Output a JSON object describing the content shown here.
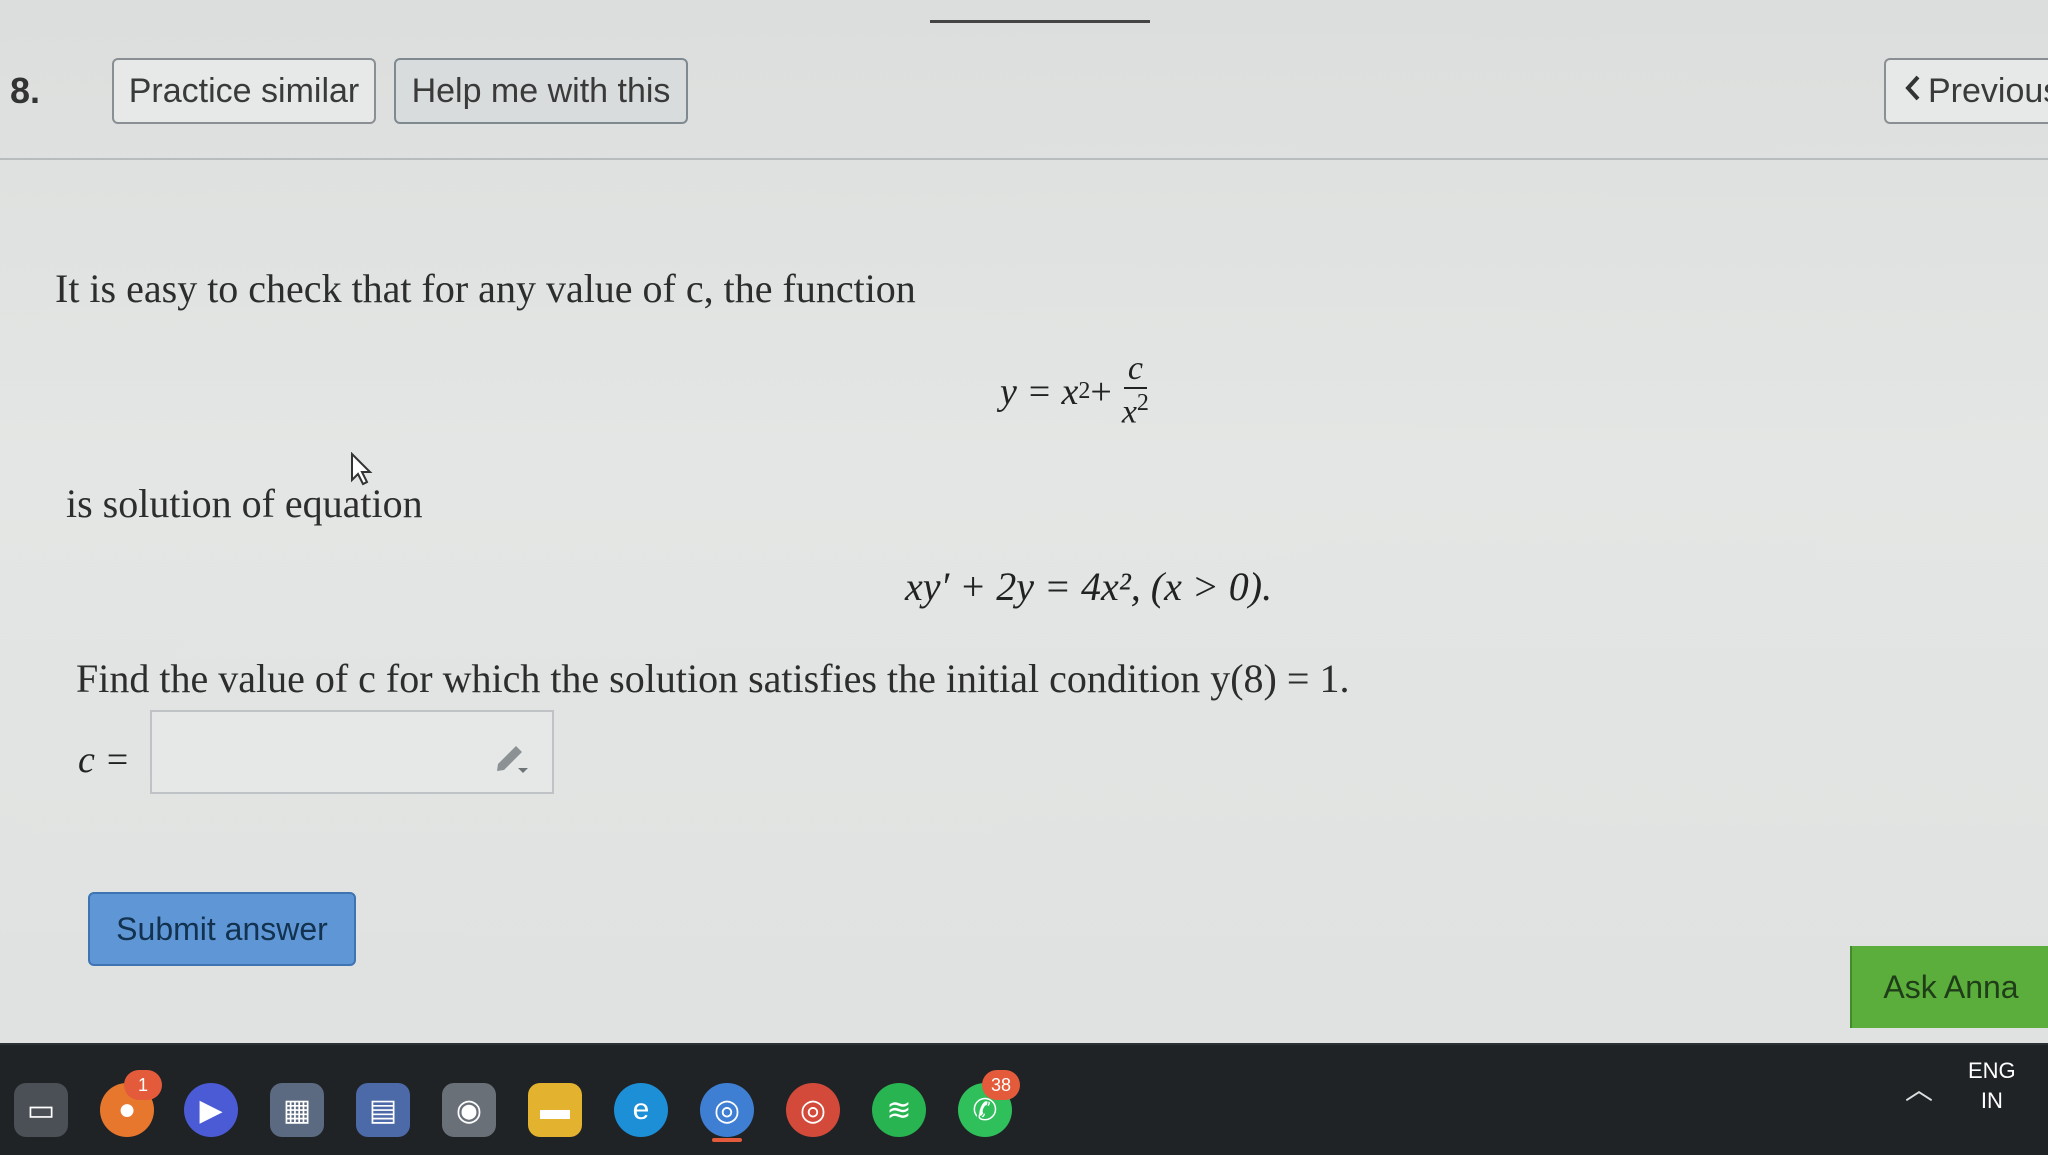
{
  "header": {
    "question_number": "8.",
    "practice_label": "Practice similar",
    "help_label": "Help me with this",
    "previous_label": "Previous"
  },
  "problem": {
    "intro": "It is easy to check that for any value of c, the function",
    "eq1_lhs": "y = x",
    "eq1_sup": "2",
    "eq1_plus": " +",
    "eq1_num": "c",
    "eq1_den": "x",
    "eq1_den_sup": "2",
    "solution_text": "is solution of equation",
    "eq2": "xy′ + 2y = 4x², (x > 0).",
    "find_text": "Find the value of c for which the solution satisfies the initial condition y(8) = 1.",
    "answer_label": "c =",
    "answer_value": ""
  },
  "actions": {
    "submit_label": "Submit answer",
    "ask_label": "Ask Anna"
  },
  "taskbar": {
    "badges": {
      "firefox": "1",
      "whatsapp": "38"
    },
    "language_top": "ENG",
    "language_bottom": "IN",
    "icons": [
      "file-explorer-icon",
      "firefox-icon",
      "zoom-icon",
      "store-icon",
      "calculator-icon",
      "camera-icon",
      "folder-icon",
      "edge-icon",
      "chrome-dev-icon",
      "chrome-icon",
      "spotify-icon",
      "whatsapp-icon"
    ]
  },
  "colors": {
    "submit_bg": "#5f97d6",
    "ask_bg": "#5bae3b",
    "taskbar_bg": "#1f2326"
  }
}
